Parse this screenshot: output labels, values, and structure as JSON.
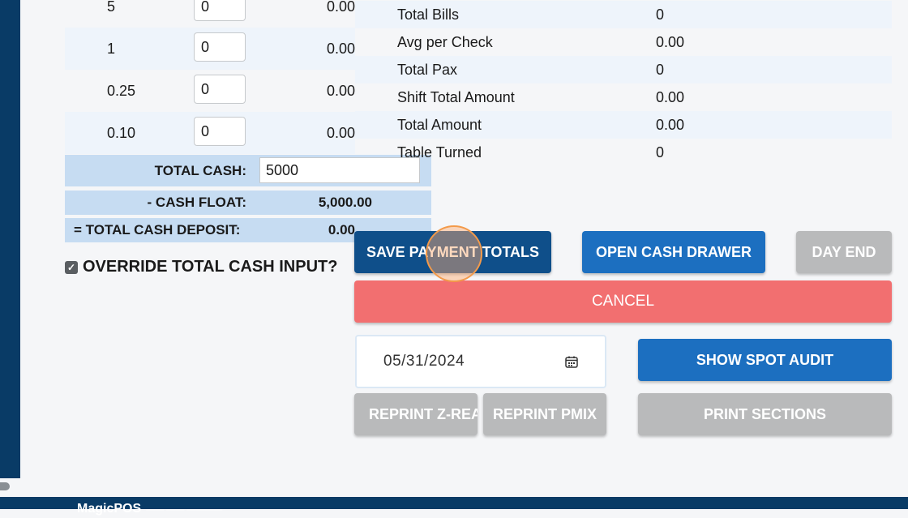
{
  "brand": {
    "name": "MagicPOS",
    "tagline": "—— —— ————"
  },
  "denominations": [
    {
      "label": "5",
      "qty": "0",
      "amount": "0.00"
    },
    {
      "label": "1",
      "qty": "0",
      "amount": "0.00"
    },
    {
      "label": "0.25",
      "qty": "0",
      "amount": "0.00"
    },
    {
      "label": "0.10",
      "qty": "0",
      "amount": "0.00"
    }
  ],
  "totals": {
    "total_cash_label": "TOTAL CASH:",
    "total_cash_value": "5000",
    "cash_float_label": "- CASH FLOAT:",
    "cash_float_value": "5,000.00",
    "deposit_label": "= TOTAL CASH DEPOSIT:",
    "deposit_value": "0.00"
  },
  "override": {
    "label": "OVERRIDE TOTAL CASH INPUT?",
    "checked": true
  },
  "stats": [
    {
      "label": "Total Bills",
      "value": "0"
    },
    {
      "label": "Avg per Check",
      "value": "0.00"
    },
    {
      "label": "Total Pax",
      "value": "0"
    },
    {
      "label": "Shift Total Amount",
      "value": "0.00"
    },
    {
      "label": "Total Amount",
      "value": "0.00"
    },
    {
      "label": "Table Turned",
      "value": "0"
    }
  ],
  "buttons": {
    "save_payment_totals": "SAVE PAYMENT TOTALS",
    "open_cash_drawer": "OPEN CASH DRAWER",
    "day_end": "DAY END",
    "cancel": "CANCEL",
    "show_spot_audit": "SHOW SPOT AUDIT",
    "reprint_z_read": "REPRINT Z-READ",
    "reprint_pmix": "REPRINT PMIX",
    "print_sections": "PRINT SECTIONS"
  },
  "date": {
    "value": "05/31/2024"
  },
  "colors": {
    "navy": "#093b66",
    "dark_blue": "#0f4f8a",
    "blue": "#1c6fc0",
    "gray": "#b9babb",
    "red": "#f26f70",
    "light_blue": "#c6dcf2"
  }
}
